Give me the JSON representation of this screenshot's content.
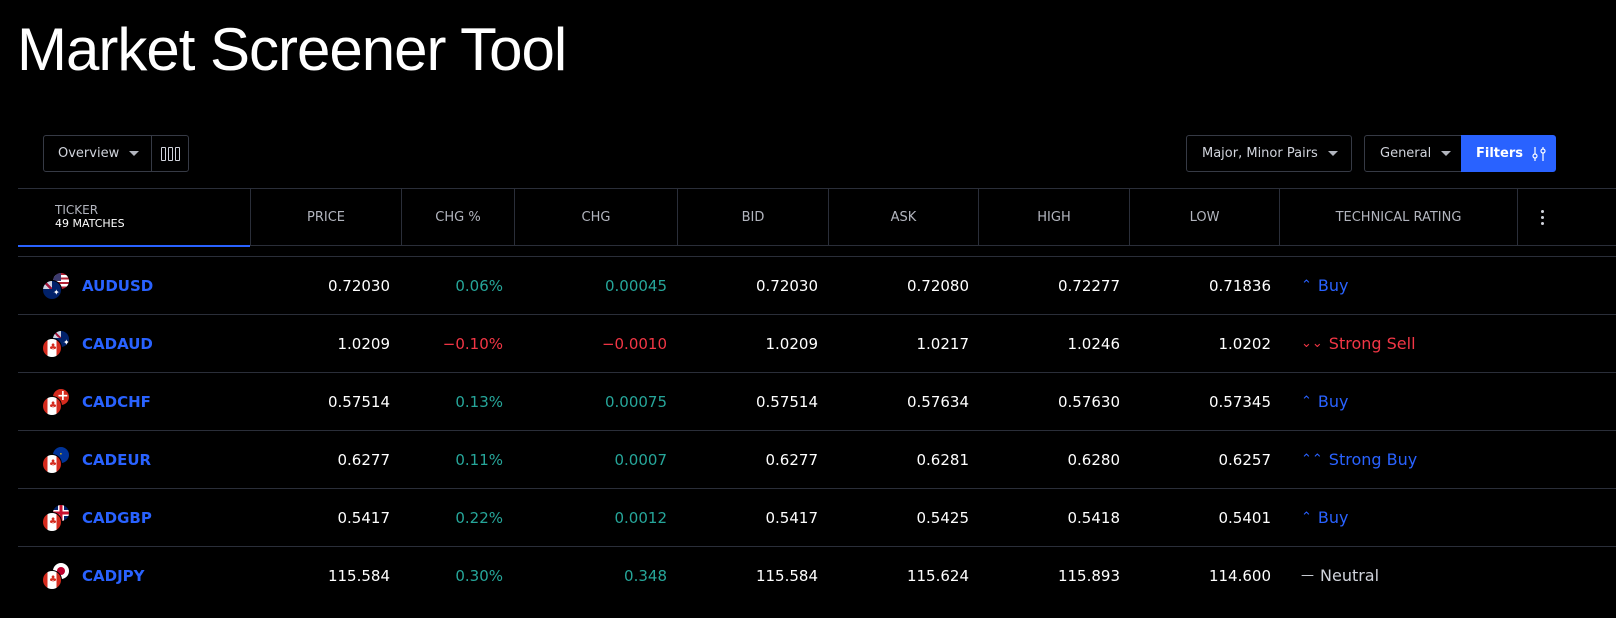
{
  "page": {
    "title": "Market Screener Tool"
  },
  "toolbar": {
    "view_label": "Overview",
    "pairs_label": "Major, Minor Pairs",
    "general_label": "General",
    "filters_label": "Filters"
  },
  "table": {
    "headers": {
      "ticker": "TICKER",
      "matches": "49 MATCHES",
      "price": "PRICE",
      "chg_pct": "CHG %",
      "chg": "CHG",
      "bid": "BID",
      "ask": "ASK",
      "high": "HIGH",
      "low": "LOW",
      "rating": "TECHNICAL RATING"
    },
    "rows": [
      {
        "symbol": "AUDUSD",
        "flags": [
          "au",
          "us"
        ],
        "price": "0.72030",
        "chg_pct": "0.06%",
        "chg": "0.00045",
        "dir": "up",
        "bid": "0.72030",
        "ask": "0.72080",
        "high": "0.72277",
        "low": "0.71836",
        "rating": "Buy",
        "rating_icon": "⌃",
        "rating_class": "r-buy"
      },
      {
        "symbol": "CADAUD",
        "flags": [
          "ca",
          "au"
        ],
        "price": "1.0209",
        "chg_pct": "−0.10%",
        "chg": "−0.0010",
        "dir": "down",
        "bid": "1.0209",
        "ask": "1.0217",
        "high": "1.0246",
        "low": "1.0202",
        "rating": "Strong Sell",
        "rating_icon": "⌄⌄",
        "rating_class": "r-strongsell"
      },
      {
        "symbol": "CADCHF",
        "flags": [
          "ca",
          "ch"
        ],
        "price": "0.57514",
        "chg_pct": "0.13%",
        "chg": "0.00075",
        "dir": "up",
        "bid": "0.57514",
        "ask": "0.57634",
        "high": "0.57630",
        "low": "0.57345",
        "rating": "Buy",
        "rating_icon": "⌃",
        "rating_class": "r-buy"
      },
      {
        "symbol": "CADEUR",
        "flags": [
          "ca",
          "eu"
        ],
        "price": "0.6277",
        "chg_pct": "0.11%",
        "chg": "0.0007",
        "dir": "up",
        "bid": "0.6277",
        "ask": "0.6281",
        "high": "0.6280",
        "low": "0.6257",
        "rating": "Strong Buy",
        "rating_icon": "⌃⌃",
        "rating_class": "r-strongbuy"
      },
      {
        "symbol": "CADGBP",
        "flags": [
          "ca",
          "gb"
        ],
        "price": "0.5417",
        "chg_pct": "0.22%",
        "chg": "0.0012",
        "dir": "up",
        "bid": "0.5417",
        "ask": "0.5425",
        "high": "0.5418",
        "low": "0.5401",
        "rating": "Buy",
        "rating_icon": "⌃",
        "rating_class": "r-buy"
      },
      {
        "symbol": "CADJPY",
        "flags": [
          "ca",
          "jp"
        ],
        "price": "115.584",
        "chg_pct": "0.30%",
        "chg": "0.348",
        "dir": "up",
        "bid": "115.584",
        "ask": "115.624",
        "high": "115.893",
        "low": "114.600",
        "rating": "Neutral",
        "rating_icon": "—",
        "rating_class": "r-neutral"
      }
    ]
  },
  "colors": {
    "accent": "#2962ff",
    "positive": "#26a69a",
    "negative": "#f23645",
    "background": "#000000"
  }
}
